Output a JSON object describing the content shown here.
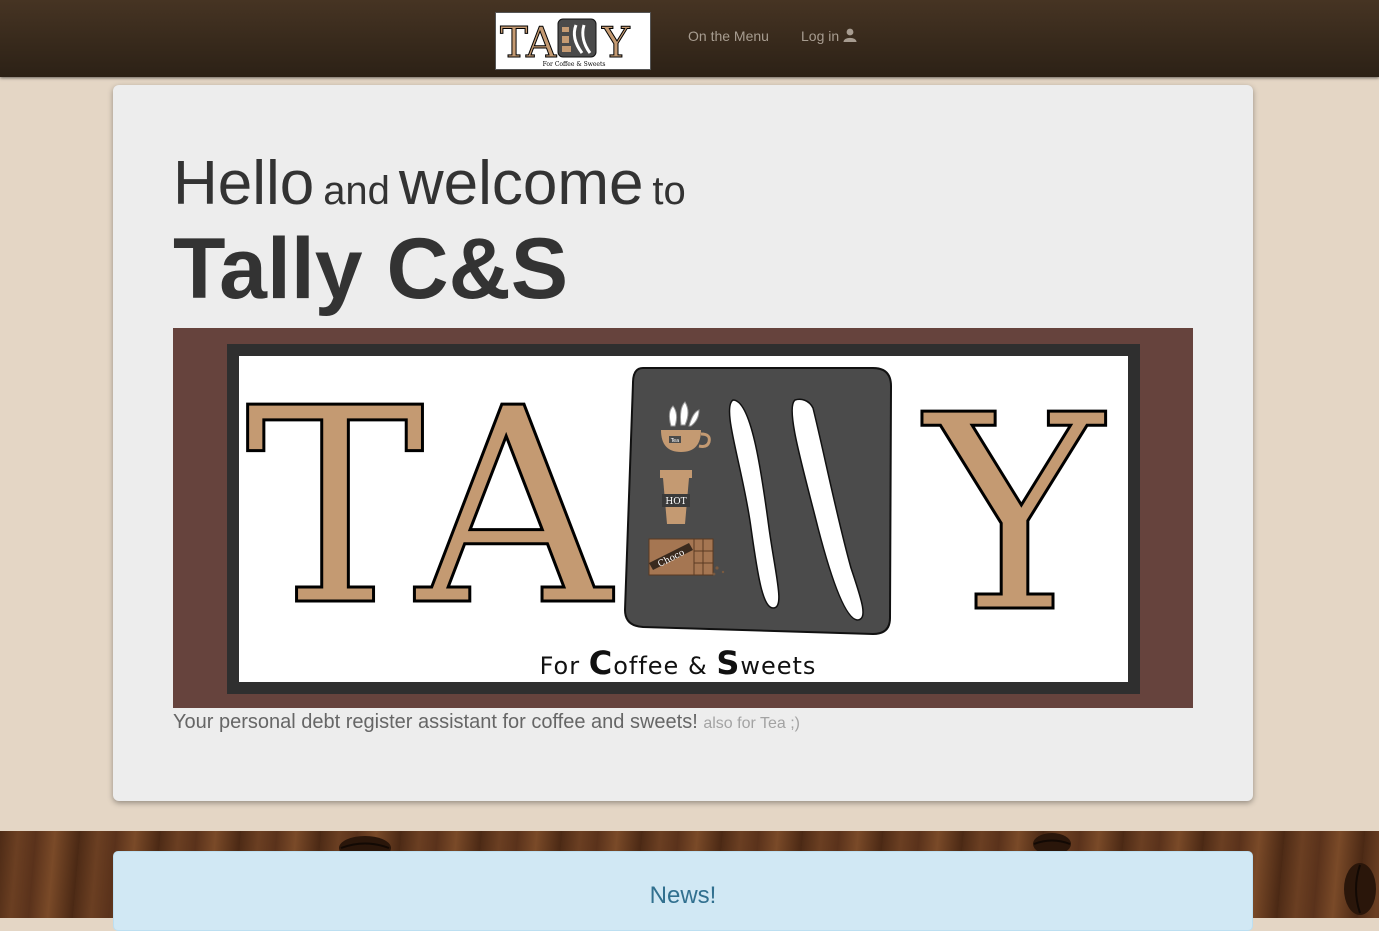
{
  "nav": {
    "brand_alt": "Tally for Coffee & Sweets",
    "menu_label": "On the Menu",
    "login_label": "Log in"
  },
  "jumbotron": {
    "greeting": {
      "hello": "Hello",
      "and": "and",
      "welcome": "welcome",
      "to": "to"
    },
    "site_name": "Tally C&S",
    "logo": {
      "letter_t": "T",
      "letter_a": "A",
      "letter_y": "Y",
      "subtitle_for": "For",
      "subtitle_c": "C",
      "subtitle_offee": "offee",
      "subtitle_amp": "&",
      "subtitle_s": "S",
      "subtitle_weets": "weets",
      "tea_label": "Tea",
      "hot_label": "HOT",
      "choco_label": "Choco"
    },
    "tagline": "Your personal debt register assistant for coffee and sweets!",
    "tagline_muted": "also for Tea ;)"
  },
  "news": {
    "title": "News!"
  },
  "colors": {
    "navbar": "#3a2b1d",
    "page_background": "#e4d6c5",
    "logo_frame": "#66433d",
    "logo_letters": "#c49a72",
    "news_background": "#d1e8f4",
    "news_text": "#31708f"
  },
  "icons": {
    "login": "user-icon"
  }
}
